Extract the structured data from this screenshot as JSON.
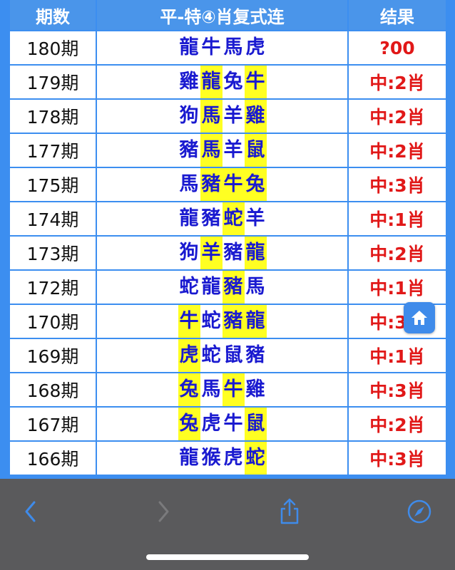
{
  "table": {
    "headers": {
      "period": "期数",
      "combo": "平-特④肖复式连",
      "result": "结果"
    },
    "rows": [
      {
        "period": "180期",
        "zodiacs": [
          "龍",
          "牛",
          "馬",
          "虎"
        ],
        "hits": [
          false,
          false,
          false,
          false
        ],
        "result": "?00"
      },
      {
        "period": "179期",
        "zodiacs": [
          "雞",
          "龍",
          "兔",
          "牛"
        ],
        "hits": [
          false,
          true,
          false,
          true
        ],
        "result": "中:2肖"
      },
      {
        "period": "178期",
        "zodiacs": [
          "狗",
          "馬",
          "羊",
          "雞"
        ],
        "hits": [
          false,
          true,
          false,
          true
        ],
        "result": "中:2肖"
      },
      {
        "period": "177期",
        "zodiacs": [
          "豬",
          "馬",
          "羊",
          "鼠"
        ],
        "hits": [
          false,
          true,
          false,
          true
        ],
        "result": "中:2肖"
      },
      {
        "period": "175期",
        "zodiacs": [
          "馬",
          "豬",
          "牛",
          "兔"
        ],
        "hits": [
          false,
          true,
          true,
          true
        ],
        "result": "中:3肖"
      },
      {
        "period": "174期",
        "zodiacs": [
          "龍",
          "豬",
          "蛇",
          "羊"
        ],
        "hits": [
          false,
          false,
          true,
          false
        ],
        "result": "中:1肖"
      },
      {
        "period": "173期",
        "zodiacs": [
          "狗",
          "羊",
          "豬",
          "龍"
        ],
        "hits": [
          false,
          true,
          false,
          true
        ],
        "result": "中:2肖"
      },
      {
        "period": "172期",
        "zodiacs": [
          "蛇",
          "龍",
          "豬",
          "馬"
        ],
        "hits": [
          false,
          false,
          true,
          false
        ],
        "result": "中:1肖"
      },
      {
        "period": "170期",
        "zodiacs": [
          "牛",
          "蛇",
          "豬",
          "龍"
        ],
        "hits": [
          true,
          false,
          true,
          true
        ],
        "result": "中:3肖"
      },
      {
        "period": "169期",
        "zodiacs": [
          "虎",
          "蛇",
          "鼠",
          "豬"
        ],
        "hits": [
          true,
          false,
          false,
          false
        ],
        "result": "中:1肖"
      },
      {
        "period": "168期",
        "zodiacs": [
          "兔",
          "馬",
          "牛",
          "雞"
        ],
        "hits": [
          true,
          false,
          true,
          false
        ],
        "result": "中:3肖"
      },
      {
        "period": "167期",
        "zodiacs": [
          "兔",
          "虎",
          "牛",
          "鼠"
        ],
        "hits": [
          true,
          false,
          false,
          true
        ],
        "result": "中:2肖"
      },
      {
        "period": "166期",
        "zodiacs": [
          "龍",
          "猴",
          "虎",
          "蛇"
        ],
        "hits": [
          false,
          false,
          false,
          true
        ],
        "result": "中:3肖"
      }
    ]
  },
  "icons": {
    "home": "home-icon",
    "back": "chevron-left-icon",
    "forward": "chevron-right-icon",
    "share": "share-icon",
    "compass": "compass-icon"
  },
  "toolbar": {
    "back_enabled": true,
    "forward_enabled": false
  },
  "colors": {
    "header_bg": "#4a95ea",
    "grid": "#3c8ef0",
    "zodiac_text": "#1a1ad0",
    "hit_highlight": "#ffff22",
    "result_text": "#e11818",
    "toolbar_bg": "#5a5a5c",
    "toolbar_icon": "#3f8bea"
  }
}
